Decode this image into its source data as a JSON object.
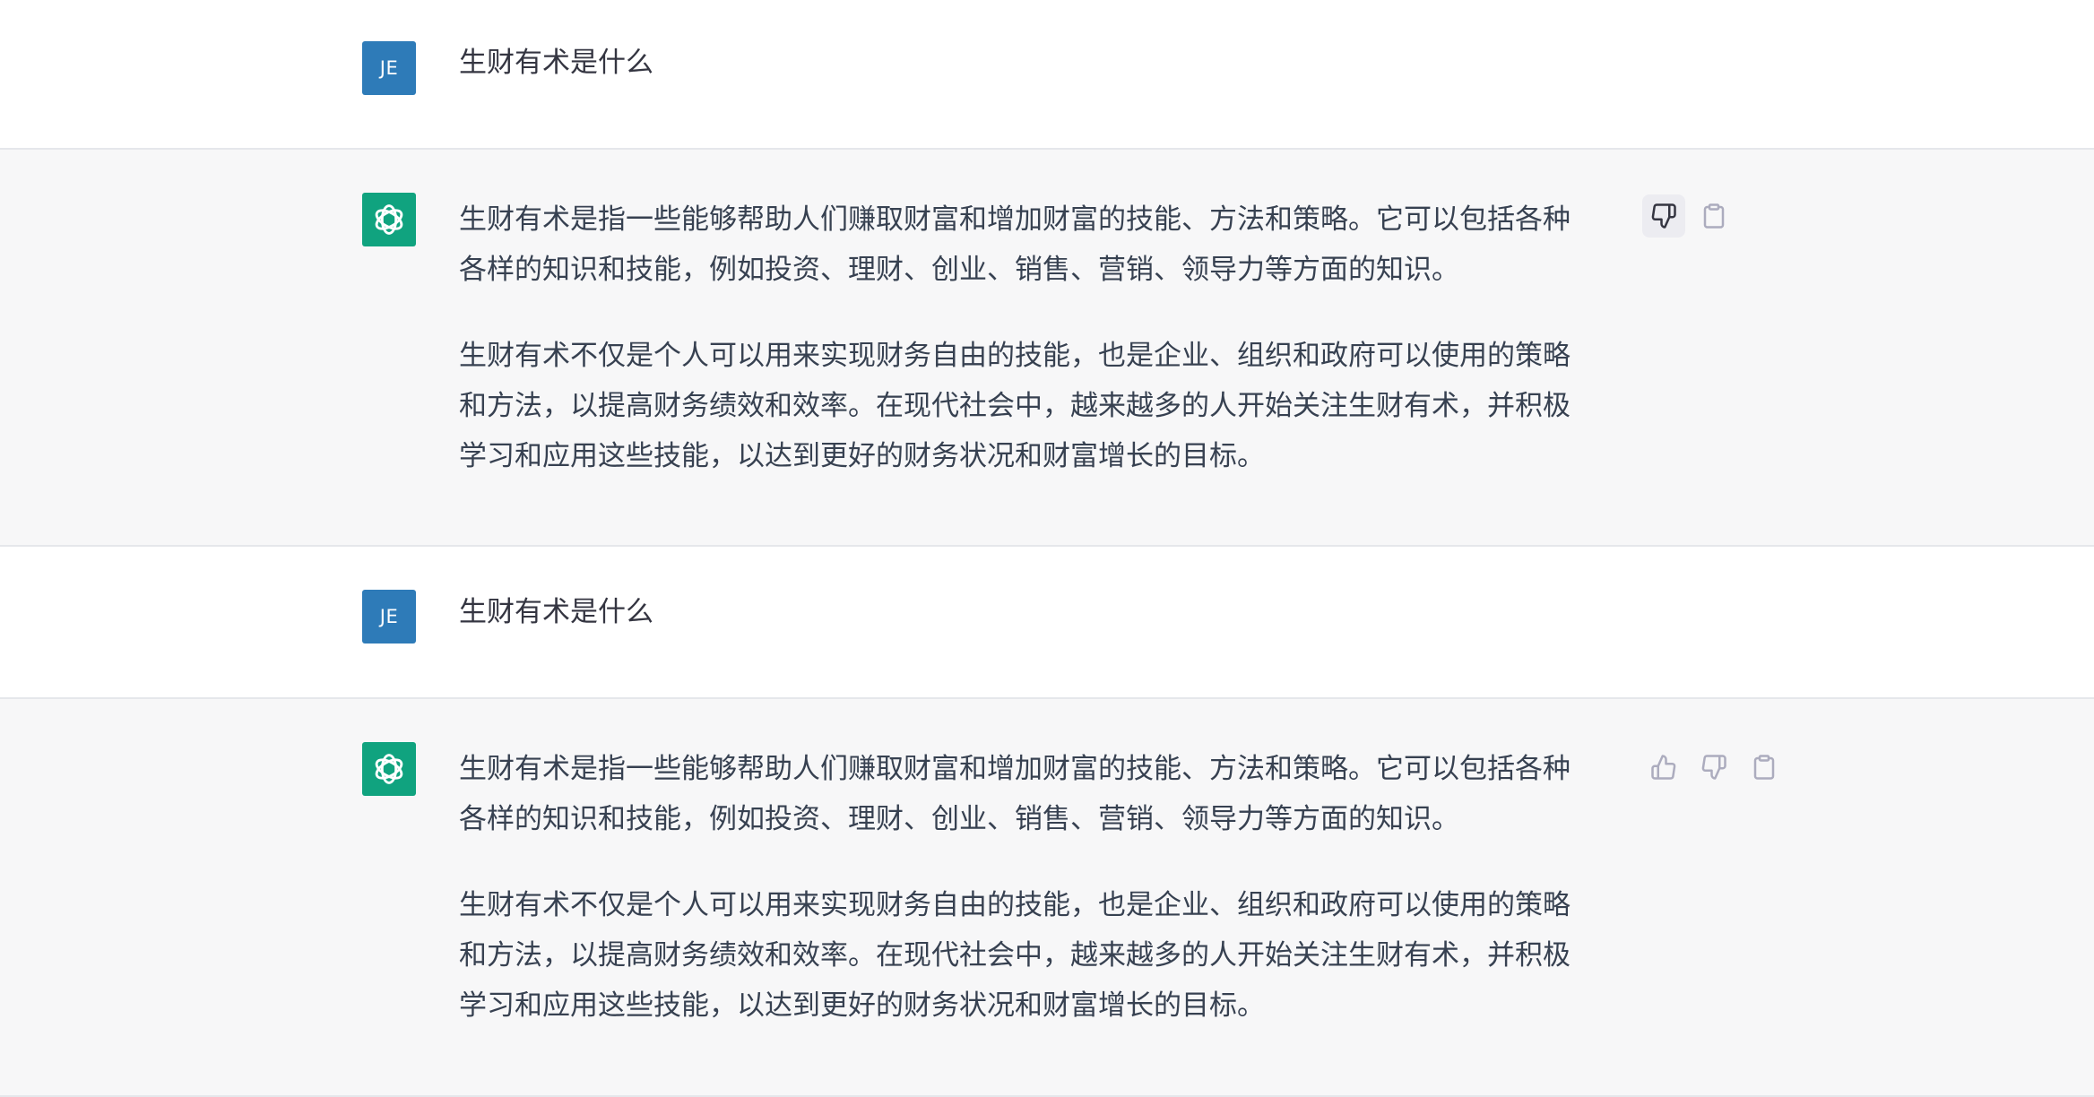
{
  "conversation": [
    {
      "role": "user",
      "avatar_initials": "JE",
      "text": "生财有术是什么"
    },
    {
      "role": "assistant",
      "avatar_icon": "openai-logo-icon",
      "paragraphs": [
        {
          "lines": [
            "生财有术是指一些能够帮助人们赚取财富和增加财富的技能、方法和策略。它可以包括各种",
            "各样的知识和技能，例如投资、理财、创业、销售、营销、领导力等方面的知识。"
          ]
        },
        {
          "lines": [
            "生财有术不仅是个人可以用来实现财务自由的技能，也是企业、组织和政府可以使用的策略",
            "和方法，以提高财务绩效和效率。在现代社会中，越来越多的人开始关注生财有术，并积极",
            "学习和应用这些技能，以达到更好的财务状况和财富增长的目标。"
          ]
        }
      ],
      "actions": [
        "thumbs-down-icon",
        "clipboard-icon"
      ]
    },
    {
      "role": "user",
      "avatar_initials": "JE",
      "text": "生财有术是什么"
    },
    {
      "role": "assistant",
      "avatar_icon": "openai-logo-icon",
      "paragraphs": [
        {
          "lines": [
            "生财有术是指一些能够帮助人们赚取财富和增加财富的技能、方法和策略。它可以包括各种",
            "各样的知识和技能，例如投资、理财、创业、销售、营销、领导力等方面的知识。"
          ]
        },
        {
          "lines": [
            "生财有术不仅是个人可以用来实现财务自由的技能，也是企业、组织和政府可以使用的策略",
            "和方法，以提高财务绩效和效率。在现代社会中，越来越多的人开始关注生财有术，并积极",
            "学习和应用这些技能，以达到更好的财务状况和财富增长的目标。"
          ]
        }
      ],
      "actions": [
        "thumbs-up-icon",
        "thumbs-down-icon",
        "clipboard-icon"
      ]
    }
  ],
  "colors": {
    "user_avatar_bg": "#2e7bb8",
    "assistant_avatar_bg": "#10a37f",
    "assistant_row_bg": "#f7f7f8"
  }
}
